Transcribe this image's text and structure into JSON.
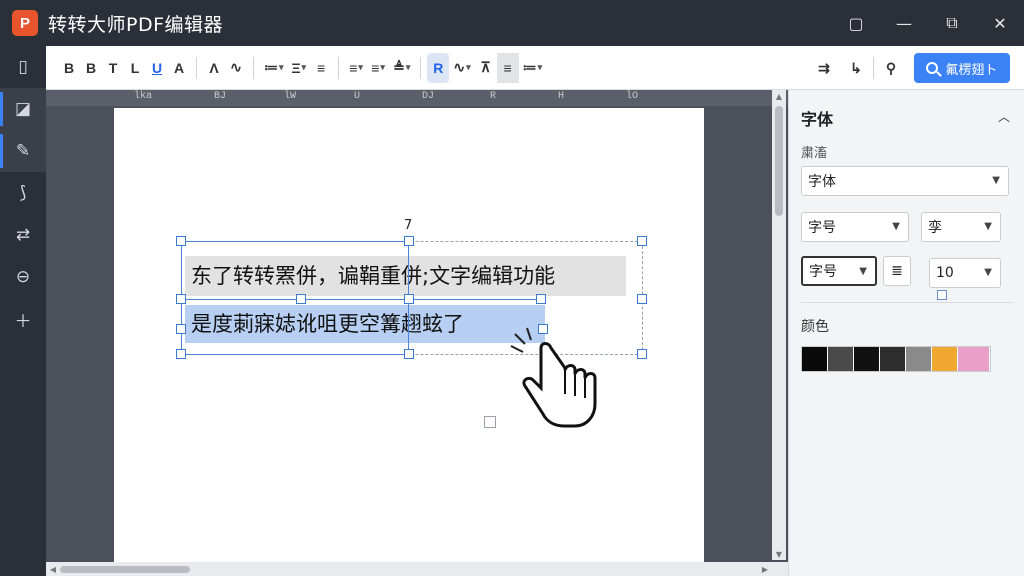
{
  "app": {
    "logo": "P",
    "title": "转转大师PDF编辑器"
  },
  "window_controls": {
    "pin": "▢",
    "minimize": "—",
    "share": "⧉",
    "close": "✕"
  },
  "left_rail": [
    "document-icon",
    "edit-page-icon",
    "pen-icon",
    "sign-icon",
    "convert-icon",
    "ocr-icon",
    "add-icon"
  ],
  "toolbar": {
    "bold_a": "B",
    "bold_b": "B",
    "italic": "T",
    "lower": "L",
    "underline": "U",
    "strike": "A",
    "caret_up": "Λ",
    "wave": "∿",
    "list1": "≔",
    "list2": "Ξ",
    "list3": "≡",
    "list4": "≡",
    "list5": "≡",
    "list6": "≜",
    "text_tool": "R",
    "curve": "∿",
    "strike2": "⊼",
    "mid": "≡",
    "indent": "≔",
    "right_tool1": "⇉",
    "right_tool2": "↳",
    "right_tool3": "⚲",
    "search_label": "氟楞翅ト"
  },
  "ruler": [
    "lka",
    "BJ",
    "lW",
    "U",
    "DJ",
    "R",
    "H",
    "lO"
  ],
  "document": {
    "rotate_marker": "7",
    "line1": "东了转转罴併，谝鞙重併;文字编辑功能",
    "line2": "是度莿寐娡讹咀更空篝趐蚿了"
  },
  "panel": {
    "title": "字体",
    "font_label": "粛滀",
    "font_family": "字体",
    "size_select": "字号",
    "style_select": "孪",
    "size_select2": "字号",
    "align_icon": "≣",
    "size_value": "10",
    "color_label": "颜色",
    "colors": [
      "#0a0a0a",
      "#4a4a4a",
      "#111111",
      "#2d2d2d",
      "#8a8a8a",
      "#f0a830",
      "#e8a0c8"
    ]
  }
}
